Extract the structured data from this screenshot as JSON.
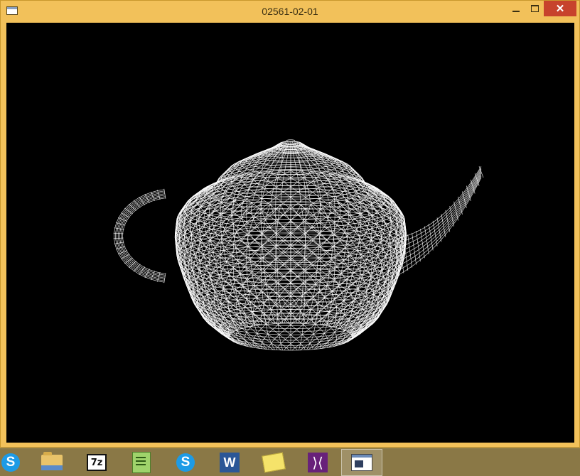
{
  "window": {
    "title": "02561-02-01",
    "close_glyph": "✕"
  },
  "viewport": {
    "content": "wireframe-teapot",
    "background": "#000000",
    "wire_color": "#ffffff"
  },
  "taskbar": {
    "items": [
      {
        "name": "skype",
        "icon": "skype-icon",
        "glyph": "S"
      },
      {
        "name": "file-explorer",
        "icon": "folder-icon"
      },
      {
        "name": "7zip",
        "icon": "7zip-icon",
        "glyph": "7z"
      },
      {
        "name": "notepad",
        "icon": "notepad-icon"
      },
      {
        "name": "skype",
        "icon": "skype-icon",
        "glyph": "S"
      },
      {
        "name": "word",
        "icon": "word-icon",
        "glyph": "W"
      },
      {
        "name": "sticky-notes",
        "icon": "sticky-notes-icon"
      },
      {
        "name": "visual-studio",
        "icon": "visual-studio-icon",
        "glyph": "⟩⟨"
      },
      {
        "name": "teapot-app",
        "icon": "app-window-icon",
        "active": true
      }
    ]
  }
}
